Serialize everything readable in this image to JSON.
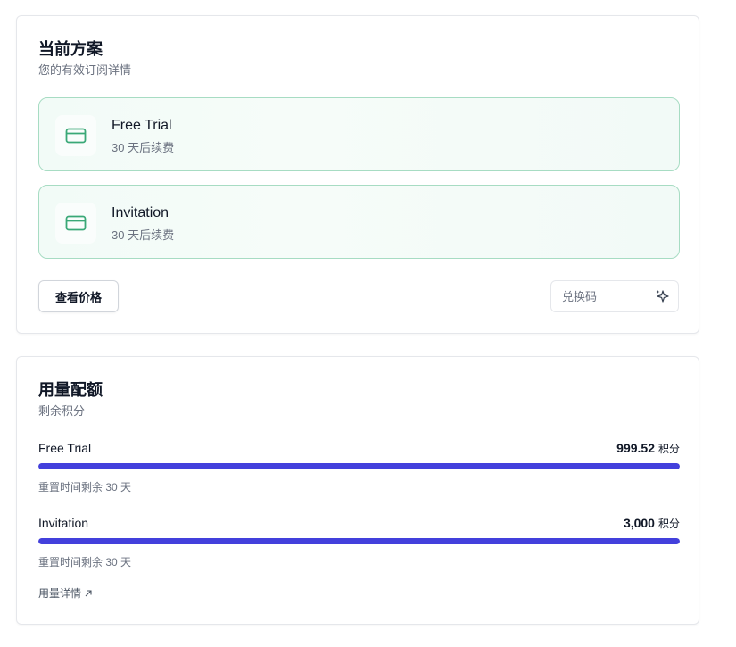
{
  "plan_card": {
    "title": "当前方案",
    "subtitle": "您的有效订阅详情",
    "plans": [
      {
        "name": "Free Trial",
        "renewal": "30 天后续费",
        "icon": "credit-card-icon"
      },
      {
        "name": "Invitation",
        "renewal": "30 天后续费",
        "icon": "credit-card-icon"
      }
    ],
    "view_pricing_label": "查看价格",
    "redeem": {
      "placeholder": "兑换码",
      "value": "",
      "icon": "sparkle-icon"
    }
  },
  "usage_card": {
    "title": "用量配额",
    "subtitle": "剩余积分",
    "items": [
      {
        "name": "Free Trial",
        "amount": "999.52",
        "unit": "积分",
        "reset": "重置时间剩余 30 天",
        "fill_fraction": 1.0
      },
      {
        "name": "Invitation",
        "amount": "3,000",
        "unit": "积分",
        "reset": "重置时间剩余 30 天",
        "fill_fraction": 1.0
      }
    ],
    "details_link": "用量详情",
    "details_icon": "arrow-up-right-icon"
  },
  "colors": {
    "accent_green": "#3aa877",
    "plan_border": "#a7dcc3",
    "bar_fill": "#4340dc",
    "muted_text": "#6b7280"
  }
}
